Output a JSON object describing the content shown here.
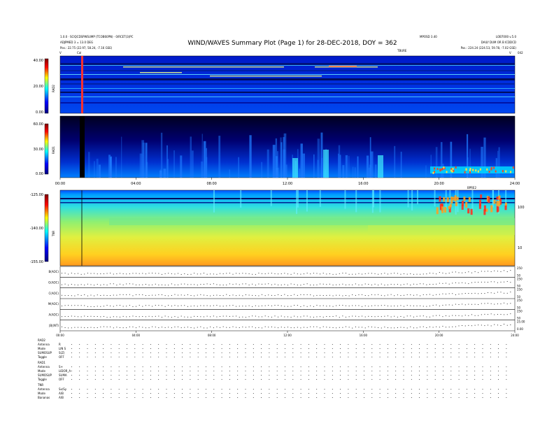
{
  "header": {
    "title": "WIND/WAVES Summary Plot (Page 1) for 28-DEC-2018, DOY = 362",
    "top_left_line1": "1.0.0 · SCIQCDSPWSUMP (TCOB60PN) · 0/RCET(3)PC",
    "top_left_line2": "ADJPMED 3 = 13.0 DEG",
    "pos_left": "Pos.:  22.75 (22.97, 58.24, -7.16 GSE)",
    "top_center_right": "MPOSD 3.40",
    "top_right_line1": "LOB7000 v.5.0",
    "top_right_line2": "DAILY DUM OR B ICDDCD",
    "pos_right": "Pos.:  224.24 (224.53, 59.78, -7.02 GSE)",
    "sub_label": "TBURE",
    "corner_v_left": "V",
    "corner_v_right": "V",
    "corner_num_right": "042",
    "cal_marker": "Cal"
  },
  "chart_data": [
    {
      "type": "heatmap",
      "panel": "rad2",
      "ylabel": "RAD2",
      "yticks": [
        "40.00",
        "20.00",
        "0.00"
      ],
      "ylim": [
        0,
        40
      ]
    },
    {
      "type": "heatmap",
      "panel": "rad1",
      "ylabel": "RAD1",
      "yticks": [
        "60.00",
        "30.00",
        "0.00"
      ],
      "ylim": [
        0,
        60
      ],
      "xticks": [
        "00:00",
        "04:00",
        "08:00",
        "12:00",
        "16:00",
        "20:00",
        "24:00"
      ]
    },
    {
      "type": "heatmap",
      "panel": "tnr",
      "ylabel": "TNR",
      "yticks": [
        "-125.00",
        "-140.00",
        "-155.00"
      ],
      "ylim": [
        -155,
        -125
      ],
      "right_ticks": [
        "100",
        "10"
      ],
      "right_label": "BPRE2"
    },
    {
      "type": "scatter",
      "panel": "traces",
      "rows": [
        {
          "label": "B(AOC)",
          "right_ticks": [
            "250",
            "50"
          ]
        },
        {
          "label": "G(AOC)",
          "right_ticks": [
            "250",
            "50"
          ]
        },
        {
          "label": "C(AOC)",
          "right_ticks": [
            "250",
            "50"
          ]
        },
        {
          "label": "M(AOC)",
          "right_ticks": [
            "250",
            "50"
          ]
        },
        {
          "label": "A(AOC)",
          "right_ticks": [
            "250",
            "50"
          ]
        },
        {
          "label": "|B|(NT)",
          "right_ticks": [
            "25.00",
            "0.00"
          ]
        }
      ],
      "xticks": [
        "00:00",
        "04:00",
        "08:00",
        "12:00",
        "16:00",
        "20:00",
        "24:00"
      ]
    }
  ],
  "footer": {
    "blocks": [
      {
        "title": "RAD2",
        "rows": [
          {
            "k": "Antenna",
            "v": "R"
          },
          {
            "k": "Mode",
            "v": "LIN S"
          },
          {
            "k": "SUMOSUP",
            "v": "S(Z)"
          },
          {
            "k": "Toggle",
            "v": "OFF"
          }
        ]
      },
      {
        "title": "RAD1",
        "rows": [
          {
            "k": "Antenna",
            "v": "S+"
          },
          {
            "k": "Mode",
            "v": "LIDOR_A"
          },
          {
            "k": "SUMOSUP",
            "v": "SUMA"
          },
          {
            "k": "Toggle",
            "v": "OFF"
          }
        ]
      },
      {
        "title": "TNR",
        "rows": [
          {
            "k": "Antenna",
            "v": "Sx/Sy"
          },
          {
            "k": "Mode",
            "v": "A/B"
          },
          {
            "k": "Bananas",
            "v": "A/B"
          }
        ]
      }
    ]
  },
  "colors": {
    "bg": "#ffffff",
    "spectro_bg": "#00009c",
    "colorbar": [
      "#00007f",
      "#0000ff",
      "#00ffff",
      "#ffff00",
      "#ff0000",
      "#7f0000"
    ]
  }
}
